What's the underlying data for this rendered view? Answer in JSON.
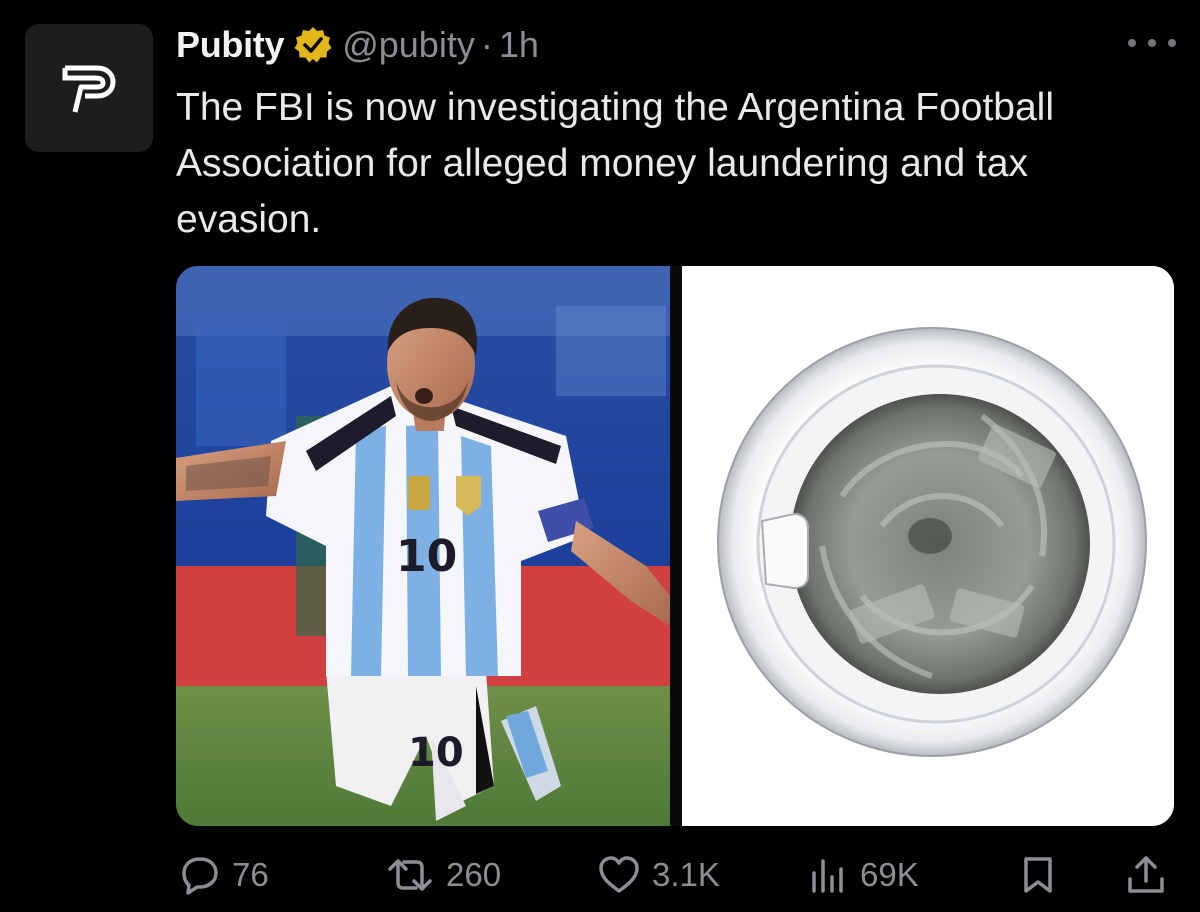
{
  "tweet": {
    "author_name": "Pubity",
    "handle": "@pubity",
    "separator": "·",
    "time": "1h",
    "text": "The FBI is now investigating the Argentina Football Association for alleged money laundering and tax evasion.",
    "verified": true
  },
  "media": {
    "images": [
      {
        "subject": "soccer player in striped jersey number 10 celebrating",
        "jersey_number": "10"
      },
      {
        "subject": "front-loading washing machine door with banknotes inside"
      }
    ]
  },
  "actions": {
    "replies": "76",
    "retweets": "260",
    "likes": "3.1K",
    "views": "69K"
  },
  "colors": {
    "background": "#000000",
    "text": "#e7e9ea",
    "muted": "#8b8f94",
    "verified_badge": "#e2b719"
  },
  "icons": [
    "pubity-logo-icon",
    "verified-badge-icon",
    "more-icon",
    "reply-icon",
    "retweet-icon",
    "like-icon",
    "views-icon",
    "bookmark-icon",
    "share-icon"
  ]
}
